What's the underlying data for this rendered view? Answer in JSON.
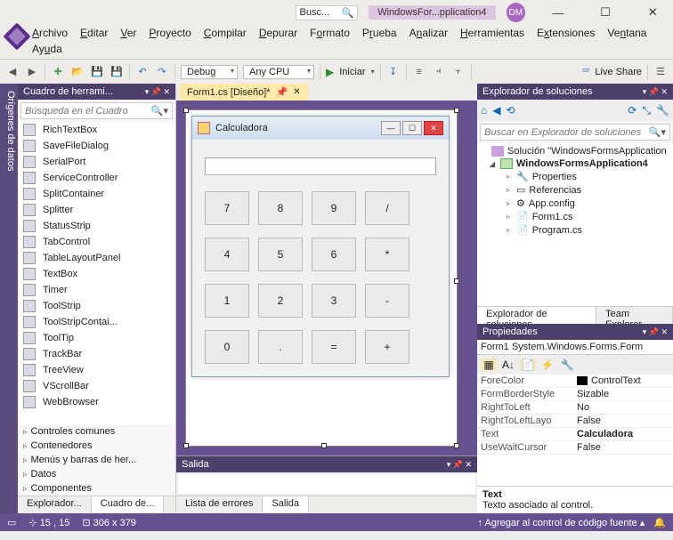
{
  "title": {
    "search_placeholder": "Busc...",
    "project": "WindowsFor...pplication4",
    "avatar": "DM"
  },
  "menu": [
    "<u>A</u>rchivo",
    "<u>E</u>ditar",
    "<u>V</u>er",
    "<u>P</u>royecto",
    "<u>C</u>ompilar",
    "<u>D</u>epurar",
    "F<u>o</u>rmato",
    "P<u>r</u>ueba",
    "A<u>n</u>alizar",
    "<u>H</u>erramientas",
    "E<u>x</u>tensiones",
    "Ve<u>n</u>tana",
    "Ay<u>u</u>da"
  ],
  "toolbar": {
    "config": "Debug",
    "platform": "Any CPU",
    "start": "Iniciar",
    "liveshare": "Live Share"
  },
  "toolbox": {
    "title": "Cuadro de herrami...",
    "search": "Búsqueda en el Cuadro",
    "items": [
      "RichTextBox",
      "SaveFileDialog",
      "SerialPort",
      "ServiceController",
      "SplitContainer",
      "Splitter",
      "StatusStrip",
      "TabControl",
      "TableLayoutPanel",
      "TextBox",
      "Timer",
      "ToolStrip",
      "ToolStripContai...",
      "ToolTip",
      "TrackBar",
      "TreeView",
      "VScrollBar",
      "WebBrowser"
    ],
    "expanders": [
      "Controles comunes",
      "Contenedores",
      "Menús y barras de her...",
      "Datos",
      "Componentes"
    ],
    "tabs": [
      "Explorador...",
      "Cuadro de..."
    ]
  },
  "doctab": "Form1.cs [Diseño]*",
  "form": {
    "title": "Calculadora",
    "buttons": [
      [
        "7",
        "8",
        "9",
        "/"
      ],
      [
        "4",
        "5",
        "6",
        "*"
      ],
      [
        "1",
        "2",
        "3",
        "-"
      ],
      [
        "0",
        ".",
        "=",
        "+"
      ]
    ]
  },
  "output": {
    "title": "Salida",
    "tabs": [
      "Lista de errores",
      "Salida"
    ]
  },
  "solnexp": {
    "title": "Explorador de soluciones",
    "search": "Buscar en Explorador de soluciones",
    "solution": "Solución \"WindowsFormsApplication",
    "project": "WindowsFormsApplication4",
    "nodes": [
      "Properties",
      "Referencias",
      "App.config",
      "Form1.cs",
      "Program.cs"
    ],
    "tabs": [
      "Explorador de soluciones",
      "Team Explorer"
    ]
  },
  "props": {
    "title": "Propiedades",
    "object": "Form1 System.Windows.Forms.Form",
    "rows": [
      {
        "k": "ForeColor",
        "v": "ControlText",
        "swatch": "#000"
      },
      {
        "k": "FormBorderStyle",
        "v": "Sizable"
      },
      {
        "k": "RightToLeft",
        "v": "No"
      },
      {
        "k": "RightToLeftLayo",
        "v": "False"
      },
      {
        "k": "Text",
        "v": "Calculadora",
        "bold": true
      },
      {
        "k": "UseWaitCursor",
        "v": "False"
      }
    ],
    "desc_title": "Text",
    "desc": "Texto asociado al control."
  },
  "status": {
    "pos": "15 , 15",
    "size": "306 x 379",
    "vcs": "Agregar al control de código fuente"
  },
  "sidetab": "Orígenes de datos"
}
